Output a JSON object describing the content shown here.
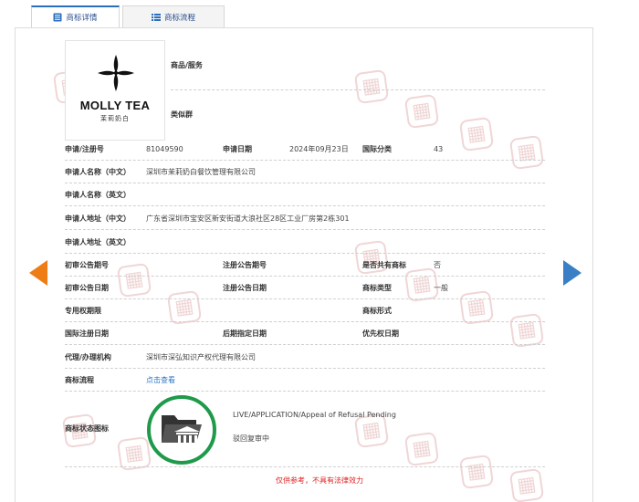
{
  "tabs": [
    {
      "label": "商标详情",
      "active": true,
      "icon": "document-list-icon"
    },
    {
      "label": "商标流程",
      "active": false,
      "icon": "process-list-icon"
    }
  ],
  "logo": {
    "name": "MOLLY TEA",
    "subtitle": "茉莉奶白"
  },
  "side_labels": {
    "goods_services": "商品/服务",
    "similar_group": "类似群"
  },
  "rows": {
    "reg_no": {
      "label": "申请/注册号",
      "value": "81049590"
    },
    "apply_date": {
      "label": "申请日期",
      "value": "2024年09月23日"
    },
    "intl_class": {
      "label": "国际分类",
      "value": "43"
    },
    "applicant_cn": {
      "label": "申请人名称（中文）",
      "value": "深圳市茉莉奶白餐饮管理有限公司"
    },
    "applicant_en": {
      "label": "申请人名称（英文）",
      "value": ""
    },
    "address_cn": {
      "label": "申请人地址（中文）",
      "value": "广东省深圳市宝安区新安街道大浪社区28区工业厂房第2栋301"
    },
    "address_en": {
      "label": "申请人地址（英文）",
      "value": ""
    },
    "prelim_pub_no": {
      "label": "初审公告期号",
      "value": ""
    },
    "reg_pub_no": {
      "label": "注册公告期号",
      "value": ""
    },
    "shared": {
      "label": "是否共有商标",
      "value": "否"
    },
    "prelim_pub_date": {
      "label": "初审公告日期",
      "value": ""
    },
    "reg_pub_date": {
      "label": "注册公告日期",
      "value": ""
    },
    "mark_type": {
      "label": "商标类型",
      "value": "一般"
    },
    "exclusive_period": {
      "label": "专用权期限",
      "value": ""
    },
    "mark_form": {
      "label": "商标形式",
      "value": ""
    },
    "intl_reg_date": {
      "label": "国际注册日期",
      "value": ""
    },
    "later_designation": {
      "label": "后期指定日期",
      "value": ""
    },
    "priority_date": {
      "label": "优先权日期",
      "value": ""
    },
    "agent": {
      "label": "代理/办理机构",
      "value": "深圳市深弘知识产权代理有限公司"
    },
    "process": {
      "label": "商标流程",
      "value": "点击查看"
    },
    "status": {
      "label": "商标状态图标"
    }
  },
  "status": {
    "english": "LIVE/APPLICATION/Appeal of Refusal Pending",
    "chinese": "驳回复审中",
    "icon": "folder-court-icon",
    "ring_color": "#1e9a4a"
  },
  "note": "仅供参考，不具有法律效力",
  "colors": {
    "tab_accent": "#2a6fbf",
    "link": "#2a78c8",
    "prev_arrow": "#ee7d16",
    "next_arrow": "#3a7fc6",
    "note": "#e02020"
  }
}
